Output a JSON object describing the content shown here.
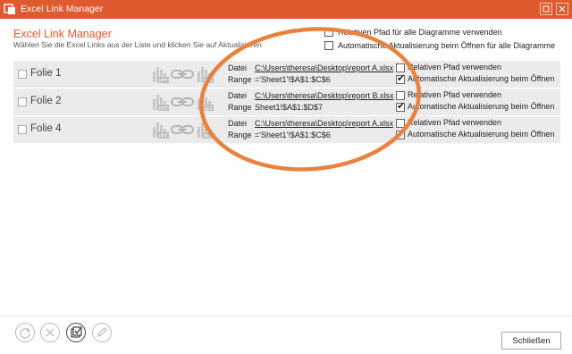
{
  "window": {
    "title": "Excel Link Manager"
  },
  "header": {
    "title": "Excel Link Manager",
    "subtitle": "Wählen Sie die Excel Links aus der Liste und klicken Sie auf Aktualisieren"
  },
  "global_options": {
    "relative_path_all": {
      "label": "Relativen Pfad für alle Diagramme verwenden",
      "checked": false
    },
    "auto_update_all": {
      "label": "Automatische Aktualisierung beim Öffnen für alle Diagramme",
      "checked": false
    }
  },
  "links": [
    {
      "slide": "Folie 1",
      "file_label": "Datei",
      "file": "C:\\Users\\theresa\\Desktop\\report A.xlsx",
      "range_label": "Range",
      "range": "='Sheet1'!$A$1:$C$6",
      "opt_relative": "Relativen Pfad verwenden",
      "relative_checked": false,
      "opt_auto": "Automatische Aktualisierung beim Öffnen",
      "auto_checked": true
    },
    {
      "slide": "Folie 2",
      "file_label": "Datei",
      "file": "C:\\Users\\theresa\\Desktop\\report B.xlsx",
      "range_label": "Range",
      "range": "Sheet1!$A$1:$D$7",
      "opt_relative": "Relativen Pfad verwenden",
      "relative_checked": false,
      "opt_auto": "Automatische Aktualisierung beim Öffnen",
      "auto_checked": true
    },
    {
      "slide": "Folie 4",
      "file_label": "Datei",
      "file": "C:\\Users\\theresa\\Desktop\\report A.xlsx",
      "range_label": "Range",
      "range": "='Sheet1'!$A$1:$C$6",
      "opt_relative": "Relativen Pfad verwenden",
      "relative_checked": false,
      "opt_auto": "Automatische Aktualisierung beim Öffnen",
      "auto_checked": false
    }
  ],
  "icons": {
    "ppt": "PPT",
    "xls": "XLS"
  },
  "toolbar": {
    "buttons": [
      "refresh-icon",
      "delete-icon",
      "select-all-icon",
      "edit-icon"
    ]
  },
  "footer": {
    "close_label": "Schließen"
  },
  "colors": {
    "accent": "#e05a2f",
    "annotation": "#e8823f"
  }
}
